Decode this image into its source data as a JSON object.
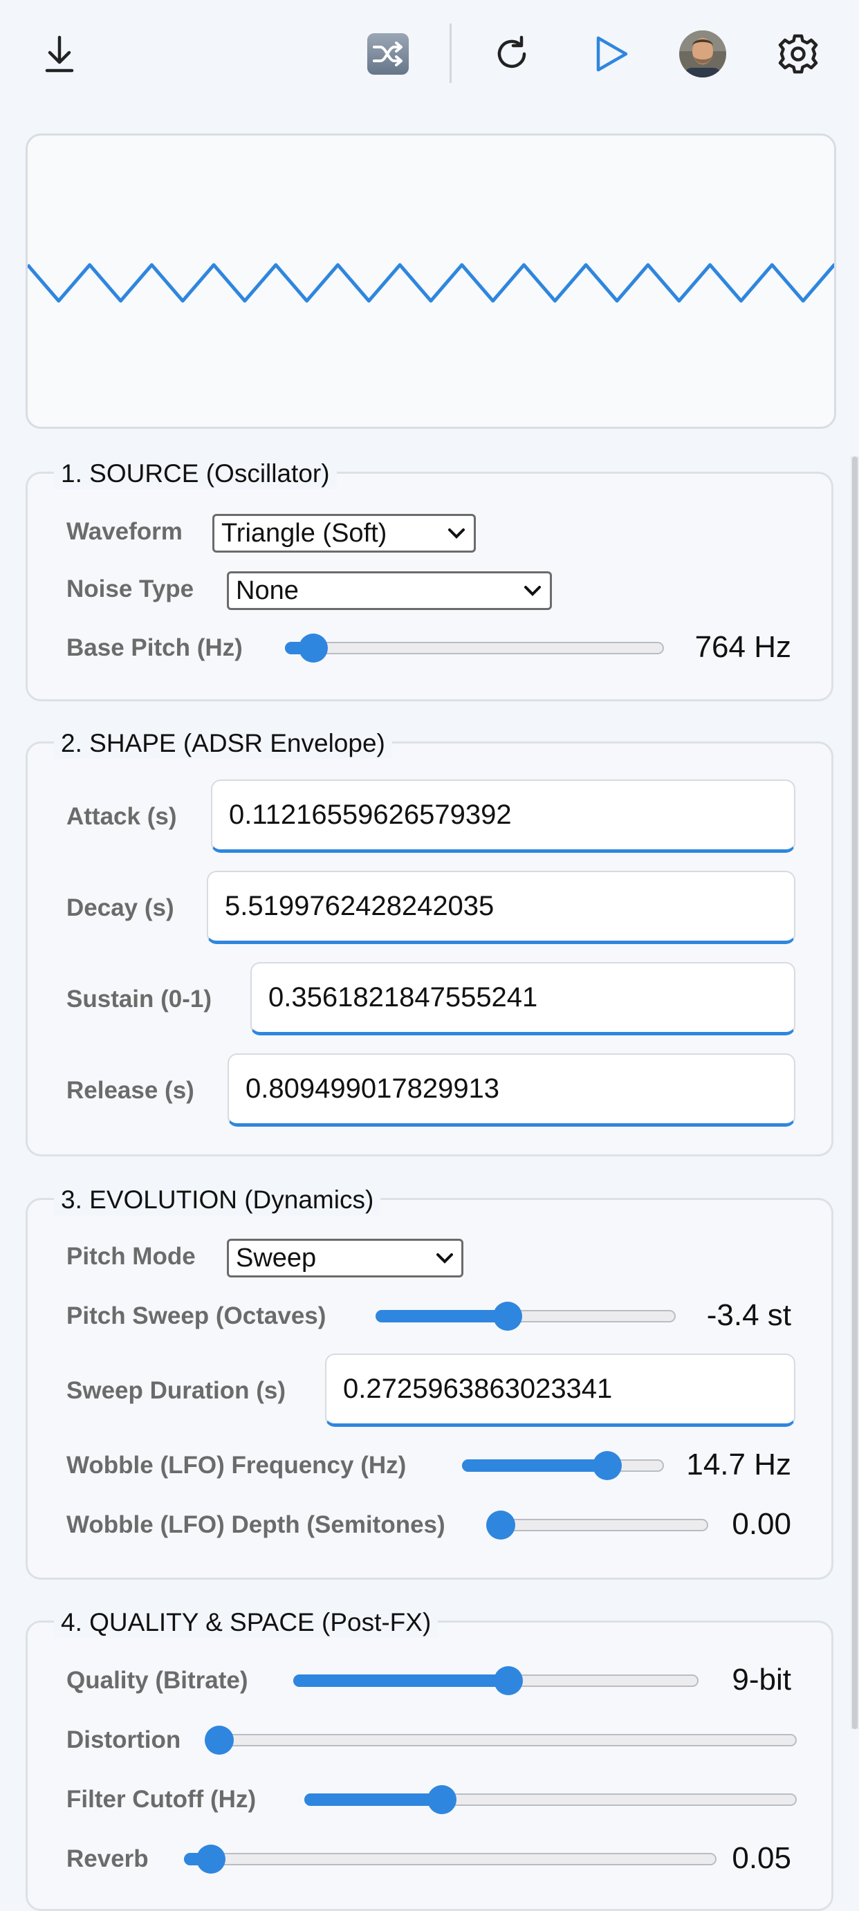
{
  "toolbar": {
    "icons": [
      "download-icon",
      "shuffle-icon",
      "reset-icon",
      "play-icon",
      "avatar",
      "gear-icon"
    ],
    "accent": "#2f86de"
  },
  "scope": {
    "waveform": "triangle",
    "cycles": 13,
    "color": "#2f86de"
  },
  "sections": {
    "source": {
      "legend": "1. SOURCE (Oscillator)",
      "waveform_label": "Waveform",
      "waveform_value": "Triangle (Soft)",
      "noise_label": "Noise Type",
      "noise_value": "None",
      "pitch_label": "Base Pitch (Hz)",
      "pitch_display": "764 Hz",
      "pitch_fraction": 0.075
    },
    "shape": {
      "legend": "2. SHAPE (ADSR Envelope)",
      "attack_label": "Attack (s)",
      "attack_value": "0.11216559626579392",
      "decay_label": "Decay (s)",
      "decay_value": "5.5199762428242035",
      "sustain_label": "Sustain (0-1)",
      "sustain_value": "0.3561821847555241",
      "release_label": "Release (s)",
      "release_value": "0.809499017829913"
    },
    "evolution": {
      "legend": "3. EVOLUTION (Dynamics)",
      "pitch_mode_label": "Pitch Mode",
      "pitch_mode_value": "Sweep",
      "sweep_label": "Pitch Sweep (Octaves)",
      "sweep_display": "-3.4 st",
      "sweep_fraction": 0.44,
      "sweep_duration_label": "Sweep Duration (s)",
      "sweep_duration_value": "0.2725963863023341",
      "lfo_freq_label": "Wobble (LFO) Frequency (Hz)",
      "lfo_freq_display": "14.7 Hz",
      "lfo_freq_fraction": 0.72,
      "lfo_depth_label": "Wobble (LFO) Depth (Semitones)",
      "lfo_depth_display": "0.00",
      "lfo_depth_fraction": 0.0
    },
    "quality": {
      "legend": "4. QUALITY & SPACE (Post-FX)",
      "bitrate_label": "Quality (Bitrate)",
      "bitrate_display": "9-bit",
      "bitrate_fraction": 0.53,
      "distortion_label": "Distortion",
      "distortion_fraction": 0.0,
      "cutoff_label": "Filter Cutoff (Hz)",
      "cutoff_fraction": 0.28,
      "reverb_label": "Reverb",
      "reverb_display": "0.05",
      "reverb_fraction": 0.05
    }
  }
}
